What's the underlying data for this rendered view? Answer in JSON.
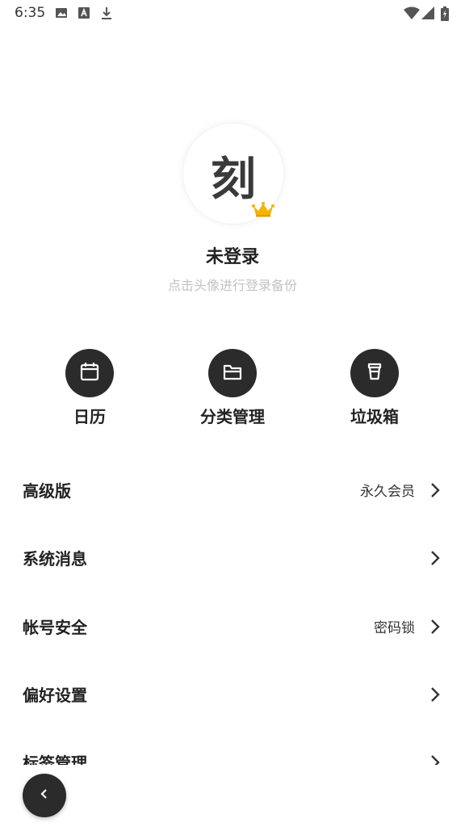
{
  "status_bar": {
    "time": "6:35",
    "icons_left": [
      "image-icon",
      "a-letter-icon",
      "download-icon"
    ],
    "icons_right": [
      "wifi-icon",
      "signal-icon",
      "battery-icon"
    ]
  },
  "profile": {
    "avatar_char": "刻",
    "badge": "crown-icon",
    "name": "未登录",
    "hint": "点击头像进行登录备份"
  },
  "quick_actions": [
    {
      "label": "日历",
      "icon": "calendar-icon"
    },
    {
      "label": "分类管理",
      "icon": "folder-icon"
    },
    {
      "label": "垃圾箱",
      "icon": "trash-icon"
    }
  ],
  "menu": [
    {
      "label": "高级版",
      "value": "永久会员"
    },
    {
      "label": "系统消息",
      "value": ""
    },
    {
      "label": "帐号安全",
      "value": "密码锁"
    },
    {
      "label": "偏好设置",
      "value": ""
    },
    {
      "label": "标签管理",
      "value": ""
    }
  ],
  "colors": {
    "dark": "#2b2b2b",
    "hint": "#c2c2c2",
    "crown": "#f5b400"
  }
}
